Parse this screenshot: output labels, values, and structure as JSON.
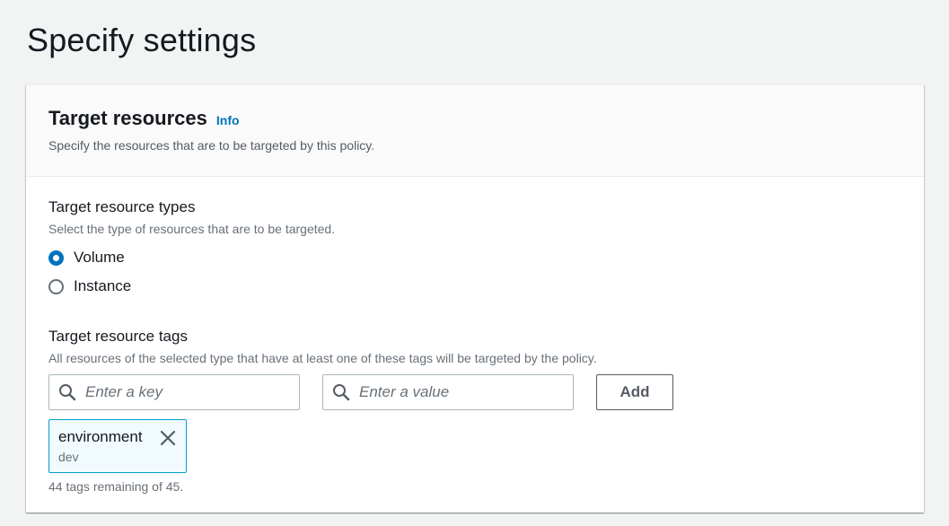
{
  "page": {
    "title": "Specify settings"
  },
  "container": {
    "title": "Target resources",
    "info_label": "Info",
    "description": "Specify the resources that are to be targeted by this policy."
  },
  "resource_types": {
    "label": "Target resource types",
    "description": "Select the type of resources that are to be targeted.",
    "options": [
      {
        "label": "Volume",
        "checked": true
      },
      {
        "label": "Instance",
        "checked": false
      }
    ]
  },
  "resource_tags": {
    "label": "Target resource tags",
    "description": "All resources of the selected type that have at least one of these tags will be targeted by the policy.",
    "key_input": {
      "placeholder": "Enter a key",
      "value": "",
      "icon": "search-icon"
    },
    "value_input": {
      "placeholder": "Enter a value",
      "value": "",
      "icon": "search-icon"
    },
    "add_label": "Add",
    "tokens": [
      {
        "key": "environment",
        "value": "dev",
        "icon": "close-icon"
      }
    ],
    "remaining_text": "44 tags remaining of 45."
  },
  "colors": {
    "accent": "#0073bb",
    "token_border": "#00a1c9",
    "token_bg": "#f1faff",
    "page_bg": "#f2f3f3"
  }
}
